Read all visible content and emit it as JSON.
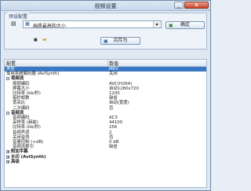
{
  "window": {
    "title": "视频设置",
    "minimize_label": "_",
    "close_label": "x"
  },
  "preset": {
    "group_label": "预设配置",
    "selected_value": "画质最高和大小",
    "confirm_label": "确定",
    "save_as_label": "另存为"
  },
  "table": {
    "headers": {
      "name": "配置",
      "value": "数值"
    },
    "rows": [
      {
        "name": "类型",
        "value": "MKV",
        "level": 0,
        "kind": "item"
      },
      {
        "name": "使用系统解码器 (AviSynth)",
        "value": "关闭",
        "level": 0,
        "kind": "item"
      },
      {
        "name": "视频流",
        "value": "",
        "level": 0,
        "kind": "category",
        "toggle": "-"
      },
      {
        "name": "视频编码",
        "value": "AVC(H264)",
        "level": 1,
        "kind": "item"
      },
      {
        "name": "屏幕大小",
        "value": "自动1280x720",
        "level": 1,
        "kind": "item"
      },
      {
        "name": "比特率 (kb/秒)",
        "value": "1200",
        "level": 1,
        "kind": "item"
      },
      {
        "name": "每秒帧数",
        "value": "缺省",
        "level": 1,
        "kind": "item"
      },
      {
        "name": "宽高比",
        "value": "自动(宽度)",
        "level": 1,
        "kind": "item"
      },
      {
        "name": "二次编码",
        "value": "否",
        "level": 1,
        "kind": "item"
      },
      {
        "name": "音频流",
        "value": "",
        "level": 0,
        "kind": "category",
        "toggle": "-"
      },
      {
        "name": "音频编码",
        "value": "AC3",
        "level": 1,
        "kind": "item"
      },
      {
        "name": "采样率 (赫兹)",
        "value": "44100",
        "level": 1,
        "kind": "item"
      },
      {
        "name": "比特率 (kb/秒)",
        "value": "256",
        "level": 1,
        "kind": "item"
      },
      {
        "name": "音频声道",
        "value": "2",
        "level": 1,
        "kind": "item"
      },
      {
        "name": "关闭音效",
        "value": "否",
        "level": 1,
        "kind": "item"
      },
      {
        "name": "音量控制 (+dB)",
        "value": "0 dB",
        "level": 1,
        "kind": "item"
      },
      {
        "name": "音频流索引",
        "value": "缺省",
        "level": 1,
        "kind": "item"
      },
      {
        "name": "附加字幕",
        "value": "",
        "level": 0,
        "kind": "category",
        "toggle": "+"
      },
      {
        "name": "水印 (AviSynth)",
        "value": "",
        "level": 0,
        "kind": "category",
        "toggle": "+"
      },
      {
        "name": "高级",
        "value": "",
        "level": 0,
        "kind": "category",
        "toggle": "+"
      }
    ]
  },
  "colors": {
    "selection": "#3b78c4",
    "window_bg": "#dfe7f1"
  },
  "icons": {
    "video_file": "video-file-icon",
    "preset_item": "preset-list-icon",
    "save_small": "small-save-icon"
  }
}
